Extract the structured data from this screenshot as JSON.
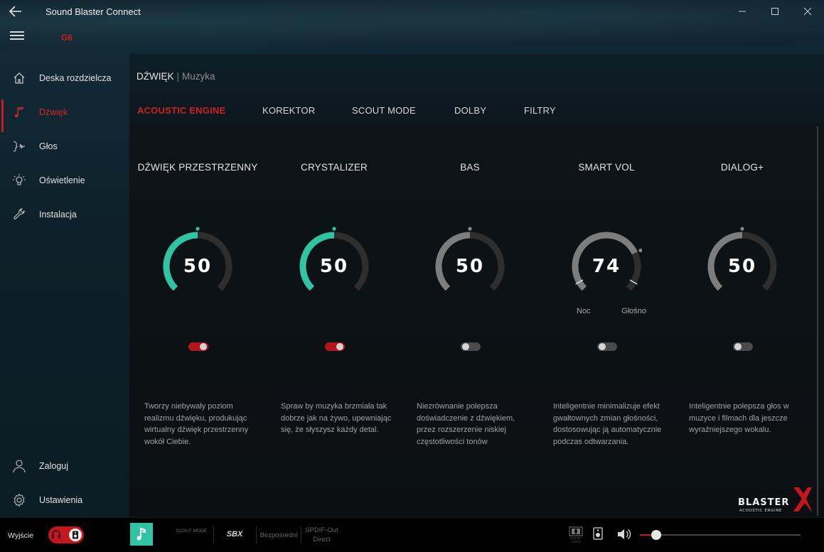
{
  "window": {
    "title": "Sound Blaster Connect",
    "device": "G6"
  },
  "sidebar": {
    "items": [
      {
        "label": "Deska rozdzielcza",
        "icon": "home-icon",
        "active": false
      },
      {
        "label": "Dźwięk",
        "icon": "music-note-icon",
        "active": true
      },
      {
        "label": "Głos",
        "icon": "voice-icon",
        "active": false
      },
      {
        "label": "Oświetlenie",
        "icon": "bulb-icon",
        "active": false
      },
      {
        "label": "Instalacja",
        "icon": "wrench-icon",
        "active": false
      }
    ],
    "bottom_items": [
      {
        "label": "Zaloguj",
        "icon": "user-icon"
      },
      {
        "label": "Ustawienia",
        "icon": "gear-icon"
      }
    ]
  },
  "header": {
    "breadcrumb_main": "DŹWIĘK",
    "breadcrumb_sep": "|",
    "breadcrumb_sub": "Muzyka"
  },
  "tabs": [
    {
      "label": "ACOUSTIC ENGINE",
      "active": true
    },
    {
      "label": "KOREKTOR",
      "active": false
    },
    {
      "label": "SCOUT MODE",
      "active": false
    },
    {
      "label": "DOLBY",
      "active": false
    },
    {
      "label": "FILTRY",
      "active": false
    }
  ],
  "cards": [
    {
      "title": "DŹWIĘK PRZESTRZENNY",
      "value": "50",
      "level": 0.5,
      "enabled": true,
      "accent": "#2fc4a3",
      "description": "Tworzy niebywały poziom realizmu dźwięku, produkując wirtualny dźwięk przestrzenny wokół Ciebie."
    },
    {
      "title": "CRYSTALIZER",
      "value": "50",
      "level": 0.5,
      "enabled": true,
      "accent": "#2fc4a3",
      "description": "Spraw by muzyka brzmiała tak dobrze jak na żywo, upewniając się, że słyszysz każdy detal."
    },
    {
      "title": "BAS",
      "value": "50",
      "level": 0.5,
      "enabled": false,
      "accent": "#7d7d7d",
      "description": "Niezrównanie polepsza doświadczenie z dźwiękiem, przez rozszerzenie niskiej częstotliwości tonów"
    },
    {
      "title": "SMART VOL",
      "value": "74",
      "level": 0.74,
      "enabled": false,
      "accent": "#7d7d7d",
      "label_low": "Noc",
      "label_high": "Głośno",
      "description": "Inteligentnie minimalizuje efekt gwałtownych zmian głośności, dostosowując ją automatycznie podczas odtwarzania."
    },
    {
      "title": "DIALOG+",
      "value": "50",
      "level": 0.5,
      "enabled": false,
      "accent": "#7d7d7d",
      "description": "Inteligentnie polepsza głos w muzyce i filmach dla jeszcze wyraźniejszego wokalu."
    }
  ],
  "bottom_bar": {
    "exit_label": "Wyjście",
    "scout_mode": "SCOUT MODE",
    "sbx": "SBX",
    "direct": "Bezpośredni",
    "spdif_line1": "SPDIF-Out",
    "spdif_line2": "Direct",
    "dolby": "DOLBY AUDIO",
    "volume_level": 0.1
  },
  "brand": {
    "logo_text": "BLASTER",
    "logo_sub": "ACOUSTIC ENGINE"
  },
  "colors": {
    "accent_red": "#c31d22",
    "accent_teal": "#2fc4a3",
    "inactive_gray": "#7d7d7d"
  }
}
